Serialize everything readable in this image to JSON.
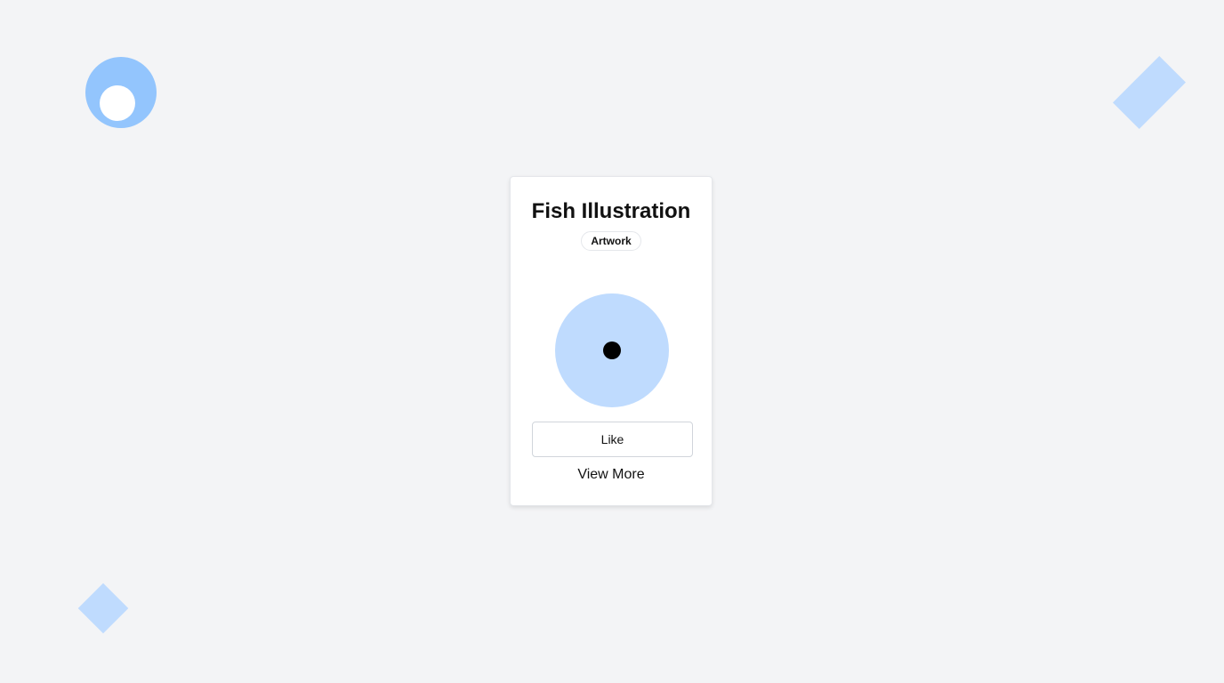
{
  "card": {
    "title": "Fish Illustration",
    "badge": "Artwork",
    "like_label": "Like",
    "view_more_label": "View More"
  },
  "colors": {
    "background": "#f3f4f6",
    "accent_light": "#bfdbfe",
    "accent": "#93c5fd",
    "card": "#ffffff"
  },
  "icons": {
    "illustration": "fish-illustration",
    "decorations": [
      "circle-decoration",
      "rectangle-decoration",
      "diamond-decoration"
    ]
  }
}
